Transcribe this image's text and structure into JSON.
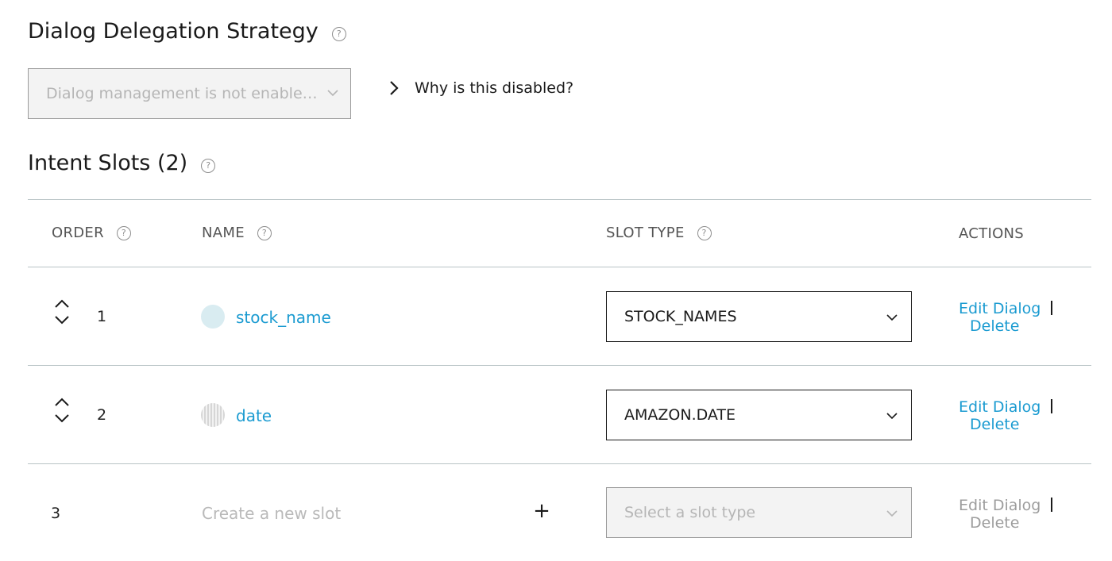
{
  "delegation": {
    "title": "Dialog Delegation Strategy",
    "select_value": "Dialog management is not enabled f…",
    "why_link": "Why is this disabled?"
  },
  "slots_section": {
    "title": "Intent Slots (2)"
  },
  "table": {
    "headers": {
      "order": "ORDER",
      "name": "NAME",
      "slot_type": "SLOT TYPE",
      "actions": "ACTIONS"
    },
    "rows": [
      {
        "order": "1",
        "name": "stock_name",
        "slot_type": "STOCK_NAMES",
        "edit_label": "Edit Dialog",
        "delete_label": "Delete"
      },
      {
        "order": "2",
        "name": "date",
        "slot_type": "AMAZON.DATE",
        "edit_label": "Edit Dialog",
        "delete_label": "Delete"
      }
    ],
    "new_row": {
      "order": "3",
      "name_placeholder": "Create a new slot",
      "type_placeholder": "Select a slot type",
      "edit_label": "Edit Dialog",
      "delete_label": "Delete"
    }
  },
  "help_glyph": "?",
  "colors": {
    "link": "#1b9bd1",
    "rule": "#b9c4c6",
    "disabled_text": "#b5b5b5"
  },
  "icons": [
    "help-icon",
    "chevron-down-icon",
    "chevron-right-icon",
    "chevron-up-icon",
    "plus-icon",
    "slot-color-dot"
  ]
}
